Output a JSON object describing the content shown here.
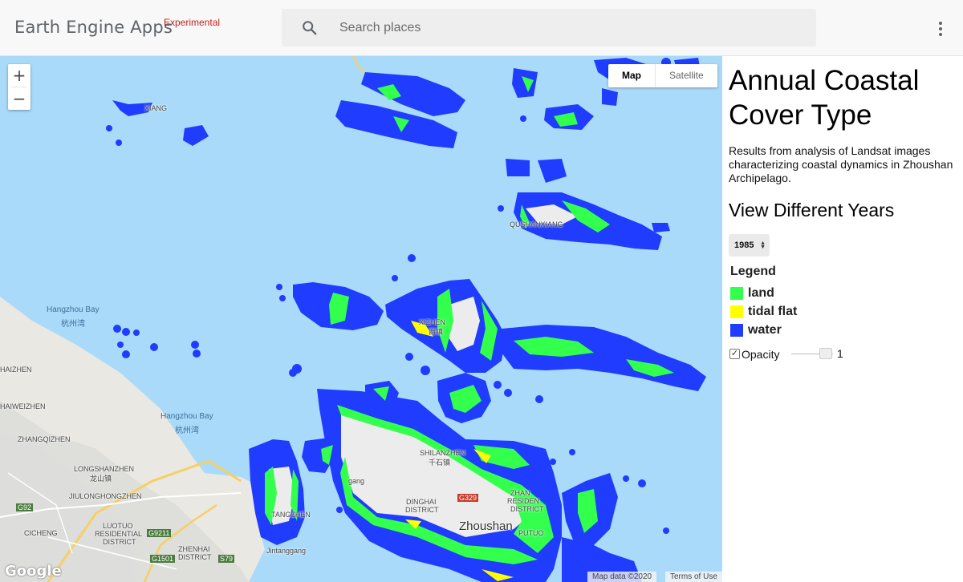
{
  "header": {
    "brand": "Earth Engine Apps",
    "brand_tag": "Experimental",
    "search_placeholder": "Search places",
    "search_value": ""
  },
  "map": {
    "zoom_in": "+",
    "zoom_out": "−",
    "type_map": "Map",
    "type_satellite": "Satellite",
    "google": "Google",
    "map_data": "Map data ©2020",
    "terms": "Terms of Use",
    "places": [
      {
        "id": "hangzhou-bay-1",
        "text": "Hangzhou Bay",
        "class": "water"
      },
      {
        "id": "hangzhou-bay-1-cn",
        "text": "杭州湾",
        "class": "water"
      },
      {
        "id": "hangzhou-bay-2",
        "text": "Hangzhou Bay",
        "class": "water"
      },
      {
        "id": "hangzhou-bay-2-cn",
        "text": "杭州湾",
        "class": "water"
      },
      {
        "id": "zhangqizhen",
        "text": "ZHANGQIZHEN",
        "class": ""
      },
      {
        "id": "longshanzhen",
        "text": "LONGSHANZHEN",
        "class": ""
      },
      {
        "id": "longshan-cn",
        "text": "龙山镇",
        "class": ""
      },
      {
        "id": "jiulongzhen",
        "text": "JIULONGHONGZHEN",
        "class": ""
      },
      {
        "id": "cicheng",
        "text": "CICHENG",
        "class": ""
      },
      {
        "id": "luotuo",
        "text": "LUOTUO",
        "class": ""
      },
      {
        "id": "residential",
        "text": "RESIDENTIAL",
        "class": ""
      },
      {
        "id": "district-1",
        "text": "DISTRICT",
        "class": ""
      },
      {
        "id": "zhenhai",
        "text": "ZHENHAI",
        "class": ""
      },
      {
        "id": "district-2",
        "text": "DISTRICT",
        "class": ""
      },
      {
        "id": "tangzhen",
        "text": "TANGZHEN",
        "class": ""
      },
      {
        "id": "jintang",
        "text": "Jintanggang",
        "class": ""
      },
      {
        "id": "dinghai",
        "text": "DINGHAI",
        "class": ""
      },
      {
        "id": "district-3",
        "text": "DISTRICT",
        "class": ""
      },
      {
        "id": "shilanzhen",
        "text": "SHILANZHEN",
        "class": ""
      },
      {
        "id": "shilan-cn",
        "text": "千石镇",
        "class": ""
      },
      {
        "id": "zhoushan",
        "text": "Zhoushan",
        "class": "big"
      },
      {
        "id": "zhan",
        "text": "ZHAN",
        "class": ""
      },
      {
        "id": "residen",
        "text": "RESIDEN",
        "class": ""
      },
      {
        "id": "district-4",
        "text": "DISTRICT",
        "class": ""
      },
      {
        "id": "putuo",
        "text": "PUTUO",
        "class": ""
      },
      {
        "id": "xizhen",
        "text": "XIZHEN",
        "class": ""
      },
      {
        "id": "xi-cn",
        "text": "西镇",
        "class": ""
      },
      {
        "id": "haizhen",
        "text": "HAIZHEN",
        "class": ""
      },
      {
        "id": "haiweizhen",
        "text": "HAIWEIZHEN",
        "class": ""
      },
      {
        "id": "xiang",
        "text": "XIANG",
        "class": ""
      },
      {
        "id": "shanxiang",
        "text": "QUSHANXIANG",
        "class": ""
      },
      {
        "id": "guang",
        "text": "gang",
        "class": ""
      },
      {
        "id": "g92",
        "text": "G92",
        "class": "shield"
      },
      {
        "id": "g9211",
        "text": "G9211",
        "class": "shield"
      },
      {
        "id": "g1501",
        "text": "G1501",
        "class": "shield"
      },
      {
        "id": "s79",
        "text": "S79",
        "class": "shield"
      },
      {
        "id": "g329",
        "text": "G329",
        "class": "shield-red"
      }
    ]
  },
  "panel": {
    "title": "Annual Coastal Cover Type",
    "description": "Results from analysis of Landsat images characterizing coastal dynamics in Zhoushan Archipelago.",
    "subtitle": "View Different Years",
    "year": "1985",
    "legend_title": "Legend",
    "legend": [
      {
        "label": "land",
        "color": "#33ff4d"
      },
      {
        "label": "tidal flat",
        "color": "#ffff00"
      },
      {
        "label": "water",
        "color": "#1f3cff"
      }
    ],
    "opacity_label": "Opacity",
    "opacity_checked": true,
    "opacity_value": "1"
  },
  "colors": {
    "sea": "#a9daf9",
    "land_base": "#e9e8e2",
    "water_class": "#1f3cff",
    "land_class": "#33ff4d",
    "tidal_class": "#ffff00",
    "brand_tag": "#c5221f"
  },
  "icons": {
    "search": "search-icon",
    "menu": "more-vert-icon"
  }
}
